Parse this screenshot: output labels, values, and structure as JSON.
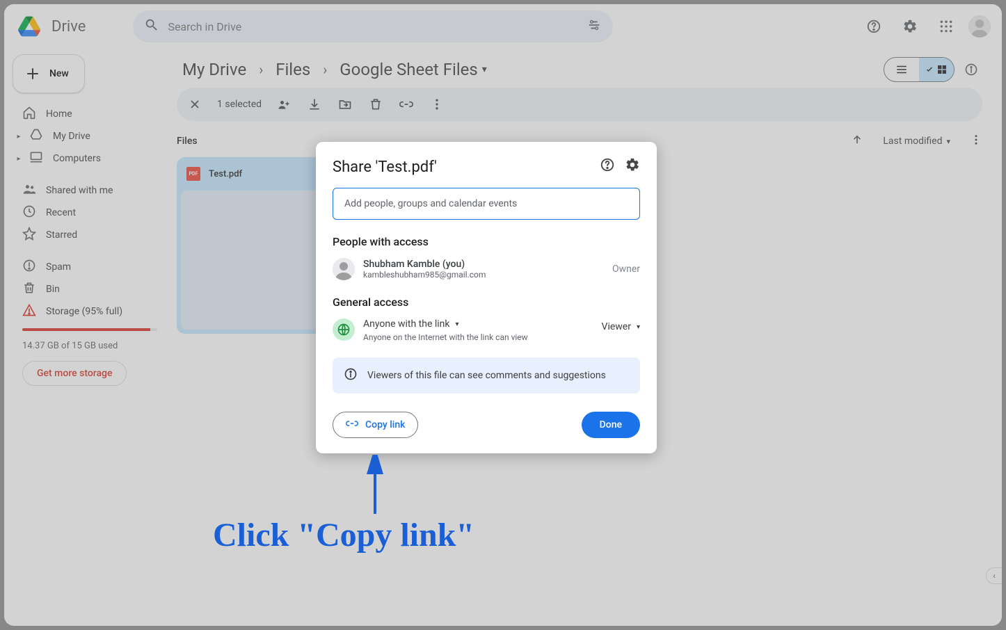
{
  "product_name": "Drive",
  "search": {
    "placeholder": "Search in Drive"
  },
  "new_button": "New",
  "sidebar": {
    "items": [
      {
        "label": "Home"
      },
      {
        "label": "My Drive"
      },
      {
        "label": "Computers"
      },
      {
        "label": "Shared with me"
      },
      {
        "label": "Recent"
      },
      {
        "label": "Starred"
      },
      {
        "label": "Spam"
      },
      {
        "label": "Bin"
      },
      {
        "label": "Storage (95% full)"
      }
    ],
    "storage_used": "14.37 GB of 15 GB used",
    "get_more": "Get more storage"
  },
  "breadcrumbs": [
    "My Drive",
    "Files",
    "Google Sheet Files"
  ],
  "selection_bar": {
    "count": "1 selected"
  },
  "list": {
    "section": "Files",
    "sort": "Last modified"
  },
  "file": {
    "name": "Test.pdf",
    "icon_text": "PDF"
  },
  "dialog": {
    "title": "Share 'Test.pdf'",
    "add_placeholder": "Add people, groups and calendar events",
    "people_heading": "People with access",
    "owner": {
      "name": "Shubham Kamble (you)",
      "email": "kambleshubham985@gmail.com",
      "role": "Owner"
    },
    "general_heading": "General access",
    "link_scope": "Anyone with the link",
    "link_desc": "Anyone on the Internet with the link can view",
    "viewer_role": "Viewer",
    "notice": "Viewers of this file can see comments and suggestions",
    "copy_link": "Copy link",
    "done": "Done"
  },
  "annotation": "Click \"Copy link\""
}
